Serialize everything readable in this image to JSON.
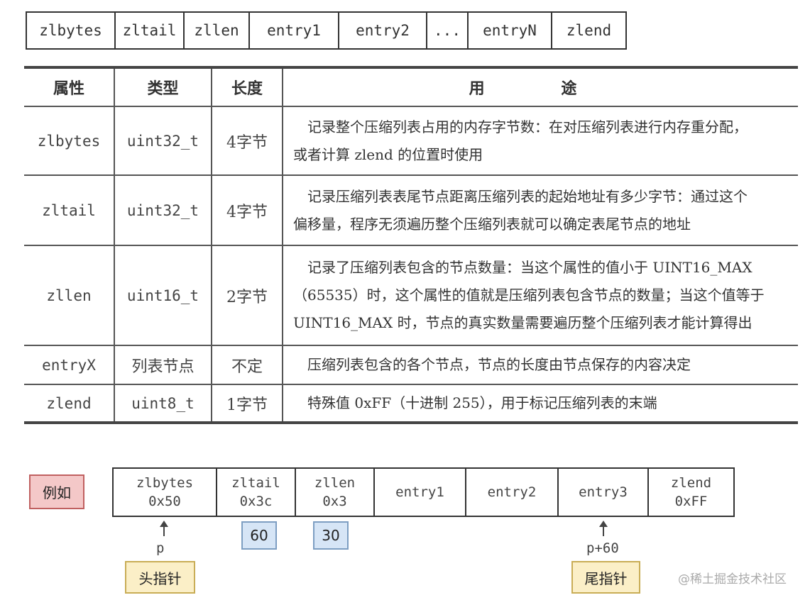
{
  "structure": {
    "cells": [
      "zlbytes",
      "zltail",
      "zllen",
      "entry1",
      "entry2",
      "...",
      "entryN",
      "zlend"
    ]
  },
  "table": {
    "headers": [
      "属性",
      "类型",
      "长度",
      "用 途"
    ],
    "rows": [
      {
        "attr": "zlbytes",
        "type": "uint32_t",
        "len": "4字节",
        "desc": [
          "记录整个压缩列表占用的内存字节数：在对压缩列表进行内存重分配，",
          "或者计算 zlend 的位置时使用"
        ]
      },
      {
        "attr": "zltail",
        "type": "uint32_t",
        "len": "4字节",
        "desc": [
          "记录压缩列表表尾节点距离压缩列表的起始地址有多少字节：通过这个",
          "偏移量，程序无须遍历整个压缩列表就可以确定表尾节点的地址"
        ]
      },
      {
        "attr": "zllen",
        "type": "uint16_t",
        "len": "2字节",
        "desc": [
          "记录了压缩列表包含的节点数量：当这个属性的值小于 UINT16_MAX",
          "（65535）时，这个属性的值就是压缩列表包含节点的数量；当这个值等于",
          "UINT16_MAX 时，节点的真实数量需要遍历整个压缩列表才能计算得出"
        ]
      },
      {
        "attr": "entryX",
        "type": "列表节点",
        "len": "不定",
        "desc": [
          "压缩列表包含的各个节点，节点的长度由节点保存的内容决定"
        ]
      },
      {
        "attr": "zlend",
        "type": "uint8_t",
        "len": "1字节",
        "desc": [
          "特殊值 0xFF（十进制 255），用于标记压缩列表的末端"
        ]
      }
    ]
  },
  "example": {
    "label": "例如",
    "cells": [
      {
        "name": "zlbytes",
        "value": "0x50"
      },
      {
        "name": "zltail",
        "value": "0x3c"
      },
      {
        "name": "zllen",
        "value": "0x3"
      },
      {
        "name": "entry1",
        "value": ""
      },
      {
        "name": "entry2",
        "value": ""
      },
      {
        "name": "entry3",
        "value": ""
      },
      {
        "name": "zlend",
        "value": "0xFF"
      }
    ],
    "zltail_decimal": "60",
    "zllen_decimal": "30",
    "head_pointer_label": "p",
    "tail_pointer_label": "p+60",
    "head_note": "头指针",
    "tail_note": "尾指针"
  },
  "watermark": "@稀土掘金技术社区",
  "colors": {
    "badge_red": "#f4c8c8",
    "badge_blue": "#d6e5f6",
    "badge_yellow": "#fbefc7"
  }
}
